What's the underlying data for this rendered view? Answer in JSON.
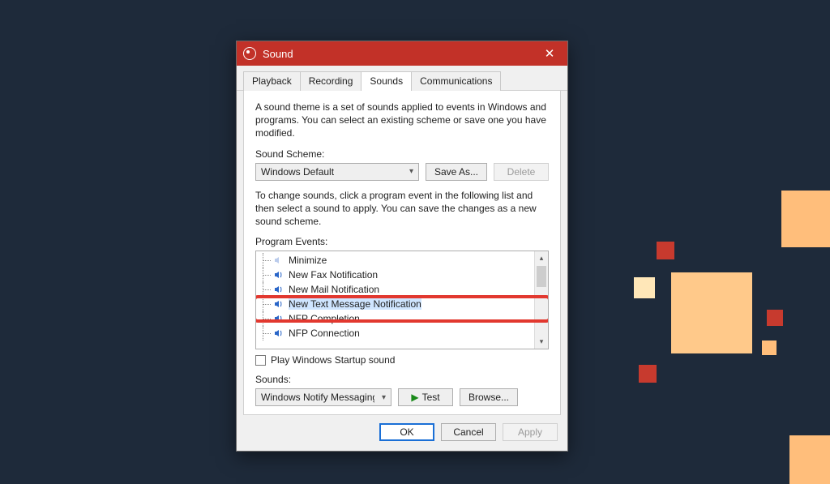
{
  "colors": {
    "titlebar": "#c23128",
    "highlight": "#e2382f",
    "accent": "#1a6fd6",
    "background": "#1e2a3a"
  },
  "window": {
    "title": "Sound",
    "close_glyph": "✕"
  },
  "tabs": [
    {
      "label": "Playback",
      "active": false
    },
    {
      "label": "Recording",
      "active": false
    },
    {
      "label": "Sounds",
      "active": true
    },
    {
      "label": "Communications",
      "active": false
    }
  ],
  "body": {
    "theme_desc": "A sound theme is a set of sounds applied to events in Windows and programs.  You can select an existing scheme or save one you have modified.",
    "scheme_label": "Sound Scheme:",
    "scheme_value": "Windows Default",
    "save_as": "Save As...",
    "delete": "Delete",
    "events_desc": "To change sounds, click a program event in the following list and then select a sound to apply.  You can save the changes as a new sound scheme.",
    "events_label": "Program Events:",
    "events": [
      {
        "label": "Minimize",
        "has_sound": false,
        "selected": false
      },
      {
        "label": "New Fax Notification",
        "has_sound": true,
        "selected": false
      },
      {
        "label": "New Mail Notification",
        "has_sound": true,
        "selected": false
      },
      {
        "label": "New Text Message Notification",
        "has_sound": true,
        "selected": true
      },
      {
        "label": "NFP Completion",
        "has_sound": true,
        "selected": false
      },
      {
        "label": "NFP Connection",
        "has_sound": true,
        "selected": false
      }
    ],
    "startup_checkbox": "Play Windows Startup sound",
    "startup_checked": false,
    "sounds_label": "Sounds:",
    "sound_value": "Windows Notify Messaging.wav",
    "test": "Test",
    "browse": "Browse..."
  },
  "footer": {
    "ok": "OK",
    "cancel": "Cancel",
    "apply": "Apply"
  }
}
